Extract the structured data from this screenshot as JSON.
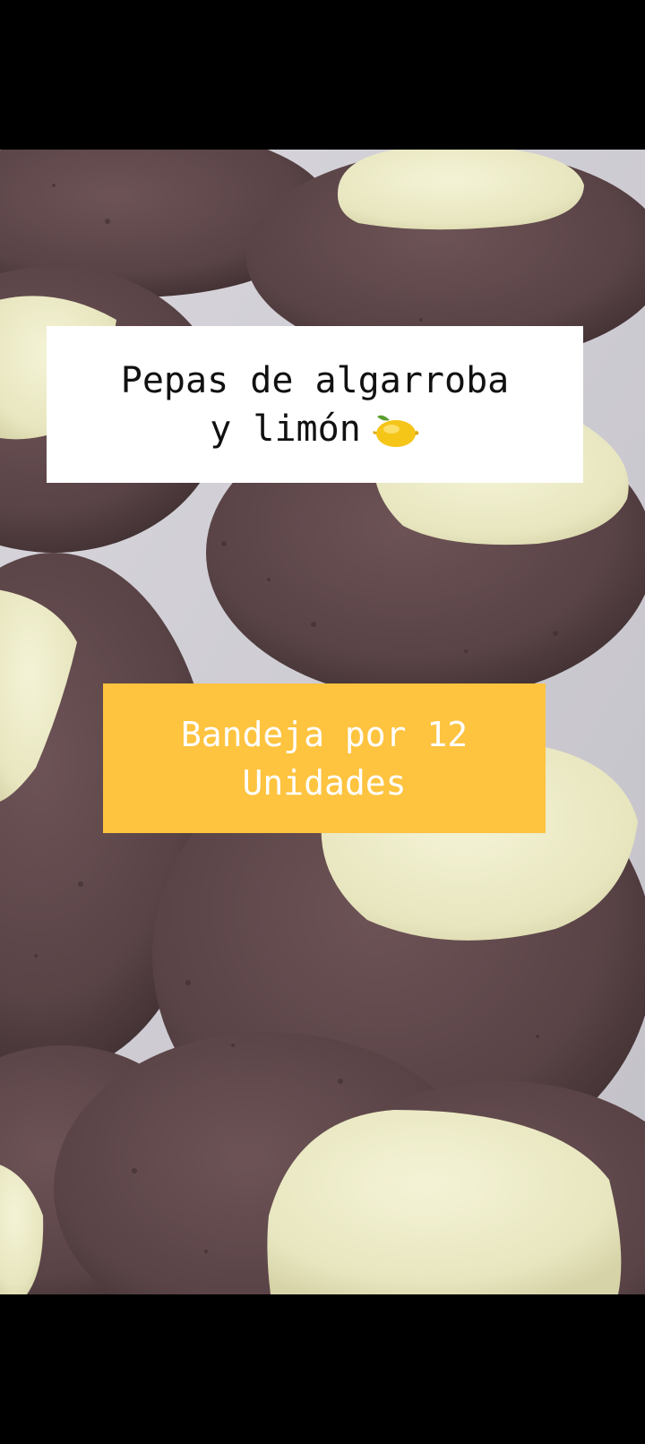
{
  "overlay": {
    "title_line1": "Pepas de algarroba",
    "title_line2": "y limón",
    "title_emoji": "lemon-icon",
    "badge_line1": "Bandeja por 12",
    "badge_line2": "Unidades"
  },
  "colors": {
    "letterbox": "#000000",
    "title_box": "#ffffff",
    "title_text": "#111111",
    "badge_box": "#fec33f",
    "badge_text": "#ffffff",
    "cookie": "#5e4649",
    "cream": "#ecebc6"
  }
}
